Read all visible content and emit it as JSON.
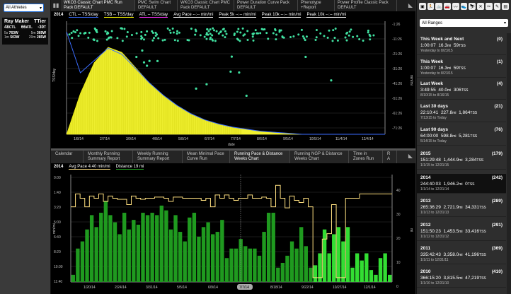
{
  "athlete_select": {
    "value": "All Athletes"
  },
  "athlete": {
    "name": "Ray Maker",
    "tier": "TTier",
    "ctl": "48",
    "ctl_unit": "CTL",
    "atl": "66",
    "atl_unit": "ATL",
    "tsb": "-30",
    "tsb_unit": "T",
    "p1_label": "5s",
    "p1": "763W",
    "p2_label": "5m",
    "p2": "369W",
    "p3_label": "1m",
    "p3": "503W",
    "p4_label": "20m",
    "p4": "285W"
  },
  "top_tabs": [
    "WKO3 Classic Chart PMC Run Pack DEFAULT",
    "PMC Swim Chart DEFAULT",
    "WKO3 Classic Chart PMC Pack DEFAULT",
    "Power Duration Curve Pack DEFAULT",
    "Phenotype +Report",
    "Power Profile Classic Pack DEFAULT"
  ],
  "mid_tabs": [
    "Calendar",
    "Monthly Running Summary Report",
    "Weekly Running Summary Report",
    "Mean Minimal Pace Curve Run",
    "Running Pace & Distance Weeks Chart",
    "Running NGP & Distance Weeks Chart",
    "Time in Zones Run",
    "R A"
  ],
  "pmc": {
    "year": "2014",
    "legend": [
      {
        "text": "CTL -- TSS/day",
        "color": "#3a6cff"
      },
      {
        "text": "TSB -- TSS/day",
        "color": "#ffff00"
      },
      {
        "text": "ATL -- TSS/day",
        "color": "#ff33ff"
      },
      {
        "text": "Avg Pace --:-- min/mi",
        "color": "#ffffff"
      },
      {
        "text": "Peak 5k --:-- min/mi",
        "color": "#ffffff"
      },
      {
        "text": "Peak 10k --:-- min/mi",
        "color": "#ffffff"
      },
      {
        "text": "Peak 10k --:-- min/mi",
        "color": "#ffffff"
      }
    ],
    "ylabel_left": "TSS/day",
    "ylabel_right": "min/mi",
    "xlabel": "date",
    "xticks": [
      "1/8/14",
      "2/7/14",
      "3/9/14",
      "4/8/14",
      "5/8/14",
      "6/7/14",
      "7/7/14",
      "8/6/14",
      "9/5/14",
      "10/5/14",
      "11/4/14",
      "12/4/14"
    ],
    "yticks_right": [
      "-1:26",
      "-11:26",
      "-21:26",
      "-31:26",
      "-41:26",
      "-51:26",
      "-61:26",
      "-71:26"
    ]
  },
  "pace": {
    "year": "2014",
    "legend_pace": "Avg Pace 4:40 min/mi",
    "legend_distance": "Distance 19 mi",
    "ylabel_left": "min/mi",
    "ylabel_right": "mi",
    "yticks_left": [
      "0:00",
      "1:40",
      "3:20",
      "5:00",
      "6:40",
      "8:20",
      "10:00",
      "11:40"
    ],
    "yticks_right": [
      "40",
      "30",
      "20",
      "10",
      "0"
    ],
    "xticks": [
      "1/20/14",
      "2/24/14",
      "3/31/14",
      "5/5/14",
      "6/9/14",
      "7/7/14",
      "8/18/14",
      "9/22/14",
      "10/27/14",
      "12/1/14"
    ],
    "highlight_label": "7/7/14"
  },
  "chart_data": [
    {
      "type": "area",
      "title": "",
      "xlabel": "date",
      "ylabel": "TSS/day",
      "series": [
        {
          "name": "TSB -- TSS/day",
          "color": "#ffff00",
          "values": [
            0,
            40,
            70,
            85,
            80,
            65,
            50,
            38,
            28,
            20,
            14,
            10,
            7,
            5,
            3,
            2,
            1,
            0,
            0,
            0,
            0,
            0,
            0,
            0
          ]
        },
        {
          "name": "CTL -- TSS/day",
          "color": "#3a6cff",
          "values": [
            100,
            60,
            72,
            84,
            78,
            64,
            50,
            38,
            28,
            20,
            14,
            10,
            7,
            5,
            3,
            2,
            1,
            0,
            0,
            0,
            0,
            0,
            0,
            0
          ]
        }
      ]
    },
    {
      "type": "bar",
      "title": "",
      "xlabel": "",
      "ylabel": "mi",
      "xticks": [
        "1/20/14",
        "2/24/14",
        "3/31/14",
        "5/5/14",
        "6/9/14",
        "7/7/14",
        "8/18/14",
        "9/22/14",
        "10/27/14",
        "12/1/14"
      ],
      "series": [
        {
          "name": "Distance",
          "color": "#22aa22",
          "values": [
            3,
            14,
            17,
            22,
            28,
            23,
            29,
            34,
            28,
            25,
            20,
            29,
            22,
            26,
            24,
            29,
            28,
            29,
            28,
            32,
            30,
            22,
            28,
            21,
            17,
            27,
            29,
            19,
            23,
            25,
            20,
            21,
            26,
            10,
            14,
            14,
            18,
            15,
            14,
            14,
            11,
            21,
            29,
            29,
            6,
            8,
            11,
            17,
            14,
            23,
            15,
            6,
            7,
            12,
            22,
            12,
            20,
            23,
            17,
            23,
            6,
            12,
            9,
            12,
            5,
            3,
            10,
            12,
            3
          ]
        },
        {
          "name": "Avg Pace",
          "color": "#ffe080",
          "values": []
        }
      ],
      "ylim": [
        0,
        45
      ]
    }
  ],
  "ranges": {
    "select_value": "All Ranges",
    "items": [
      {
        "title": "This Week and Next",
        "count": "(0)",
        "time": "1:00:07",
        "dist": "16.3",
        "dist_unit": "mi",
        "tss": "59",
        "tss_unit": "TSS",
        "dates": "Yesterday to 8/23/15"
      },
      {
        "title": "This Week",
        "count": "(1)",
        "time": "1:00:07",
        "dist": "16.3",
        "dist_unit": "mi",
        "tss": "59",
        "tss_unit": "TSS",
        "dates": "Yesterday to 8/23/15"
      },
      {
        "title": "Last Week",
        "count": "(4)",
        "time": "3:49:55",
        "dist": "40.0",
        "dist_unit": "mi",
        "tss": "306",
        "tss_unit": "TSS",
        "dates": "8/10/15 to 8/16/15"
      },
      {
        "title": "Last 30 days",
        "count": "(21)",
        "time": "22:10:41",
        "dist": "227.8",
        "dist_unit": "mi",
        "tss": "1,864",
        "tss_unit": "TSS",
        "dates": "7/13/15 to Today"
      },
      {
        "title": "Last 90 days",
        "count": "(76)",
        "time": "64:00:00",
        "dist": "598.8",
        "dist_unit": "mi",
        "tss": "5,281",
        "tss_unit": "TSS",
        "dates": "5/14/15 to Today"
      },
      {
        "title": "2015",
        "count": "(179)",
        "time": "151:29:48",
        "dist": "1,444.9",
        "dist_unit": "mi",
        "tss": "3,284",
        "tss_unit": "TSS",
        "dates": "1/1/15 to 12/31/15"
      },
      {
        "title": "2014",
        "count": "(242)",
        "time": "244:40:03",
        "dist": "1,946.2",
        "dist_unit": "mi",
        "tss": "0",
        "tss_unit": "TSS",
        "dates": "1/1/14 to 12/31/14",
        "selected": true
      },
      {
        "title": "2013",
        "count": "(289)",
        "time": "265:36:29",
        "dist": "2,721.9",
        "dist_unit": "mi",
        "tss": "34,331",
        "tss_unit": "TSS",
        "dates": "1/1/13 to 12/31/13"
      },
      {
        "title": "2012",
        "count": "(291)",
        "time": "151:50:23",
        "dist": "1,453.5",
        "dist_unit": "mi",
        "tss": "33,416",
        "tss_unit": "TSS",
        "dates": "1/1/12 to 12/31/12"
      },
      {
        "title": "2011",
        "count": "(369)",
        "time": "335:42:43",
        "dist": "3,358.0",
        "dist_unit": "mi",
        "tss": "41,196",
        "tss_unit": "TSS",
        "dates": "1/1/11 to 12/31/11"
      },
      {
        "title": "2010",
        "count": "(410)",
        "time": "366:15:20",
        "dist": "3,815.5",
        "dist_unit": "mi",
        "tss": "47,219",
        "tss_unit": "TSS",
        "dates": "1/1/10 to 12/31/10"
      }
    ]
  },
  "toolbar_icons": [
    "window-icon",
    "run-icon",
    "bike-icon",
    "car-icon",
    "swim-icon",
    "shoe-icon",
    "ski-icon",
    "tools-icon",
    "scissors-icon",
    "pen-icon",
    "stats-icon"
  ]
}
